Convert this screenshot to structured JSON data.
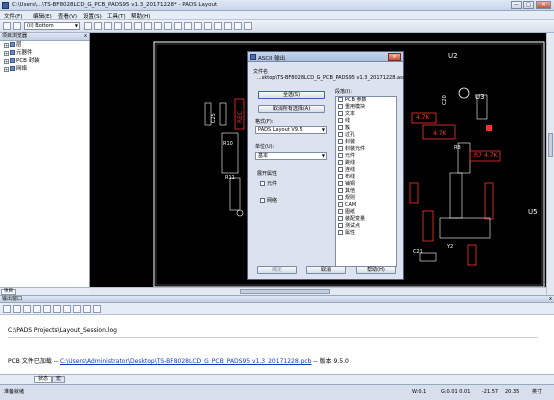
{
  "window": {
    "title": "C:\\Users\\...\\TS-BF8028LCD_G_PCB_PADS95 v1.3_20171228* - PADS Layout",
    "minimize": "—",
    "maximize": "□",
    "close": "✕"
  },
  "menu": [
    "文件(F)",
    "编辑(E)",
    "查看(V)",
    "设置(S)",
    "工具(T)",
    "帮助(H)"
  ],
  "toolbar": {
    "layer_value": "(ii) Bottom"
  },
  "project_panel": {
    "title": "项目浏览器",
    "close": "x",
    "items": [
      {
        "label": "层"
      },
      {
        "label": "元器件"
      },
      {
        "label": "PCB 封装"
      },
      {
        "label": "网络"
      }
    ],
    "tab": "项目"
  },
  "board": {
    "labels_white": [
      "U2",
      "U3",
      "C20",
      "R8",
      "U5",
      "C21",
      "Y2",
      "C25",
      "R10",
      "R11"
    ],
    "labels_red": [
      "R7",
      "4.7K",
      "4.7K",
      "4.7K",
      "REC"
    ]
  },
  "dialog": {
    "title": "ASCII 输出",
    "close": "✕",
    "filename_label": "文件名",
    "filename_value": "...sktop\\TS-BF8028LCD_G_PCB_PADS95 v1.3_20171228.asc",
    "select_all": "全选(S)",
    "deselect_all": "取消所有选择(A)",
    "format_label": "格式(F):",
    "format_value": "PADS Layout V9.5",
    "units_label": "单位(U):",
    "units_value": "基本",
    "expand_label": "展开属性",
    "expand_parts": "元件",
    "expand_nets": "网络",
    "section_label": "段落(I):",
    "sections": [
      "PCB 参数",
      "重用模块",
      "文本",
      "线",
      "簇",
      "过孔",
      "封装",
      "封装元件",
      "元件",
      "跳线",
      "连线",
      "布线",
      "铺铜",
      "其他",
      "规则",
      "CAM",
      "图纸",
      "装配变量",
      "测试点",
      "属性"
    ],
    "ok": "确定",
    "cancel": "取消",
    "help": "帮助(H)"
  },
  "output": {
    "title": "输出窗口",
    "close": "x",
    "line1": "C:\\PADS Projects\\Layout_Session.log",
    "line2_prefix": "PCB 文件已加载 -- ",
    "line2_link": "C:\\Users\\Administrator\\Desktop\\TS-BF8028LCD_G_PCB_PADS95 v1.3_20171228.pcb",
    "line2_suffix": " -- 版本 9.5.0",
    "tabs": [
      "状态",
      "宏"
    ]
  },
  "status": {
    "ready": "准备就绪",
    "w": "W:0.1",
    "g": "G:0.01 0.01",
    "x": "-21.57",
    "y": "20.35",
    "unit": "英寸"
  }
}
